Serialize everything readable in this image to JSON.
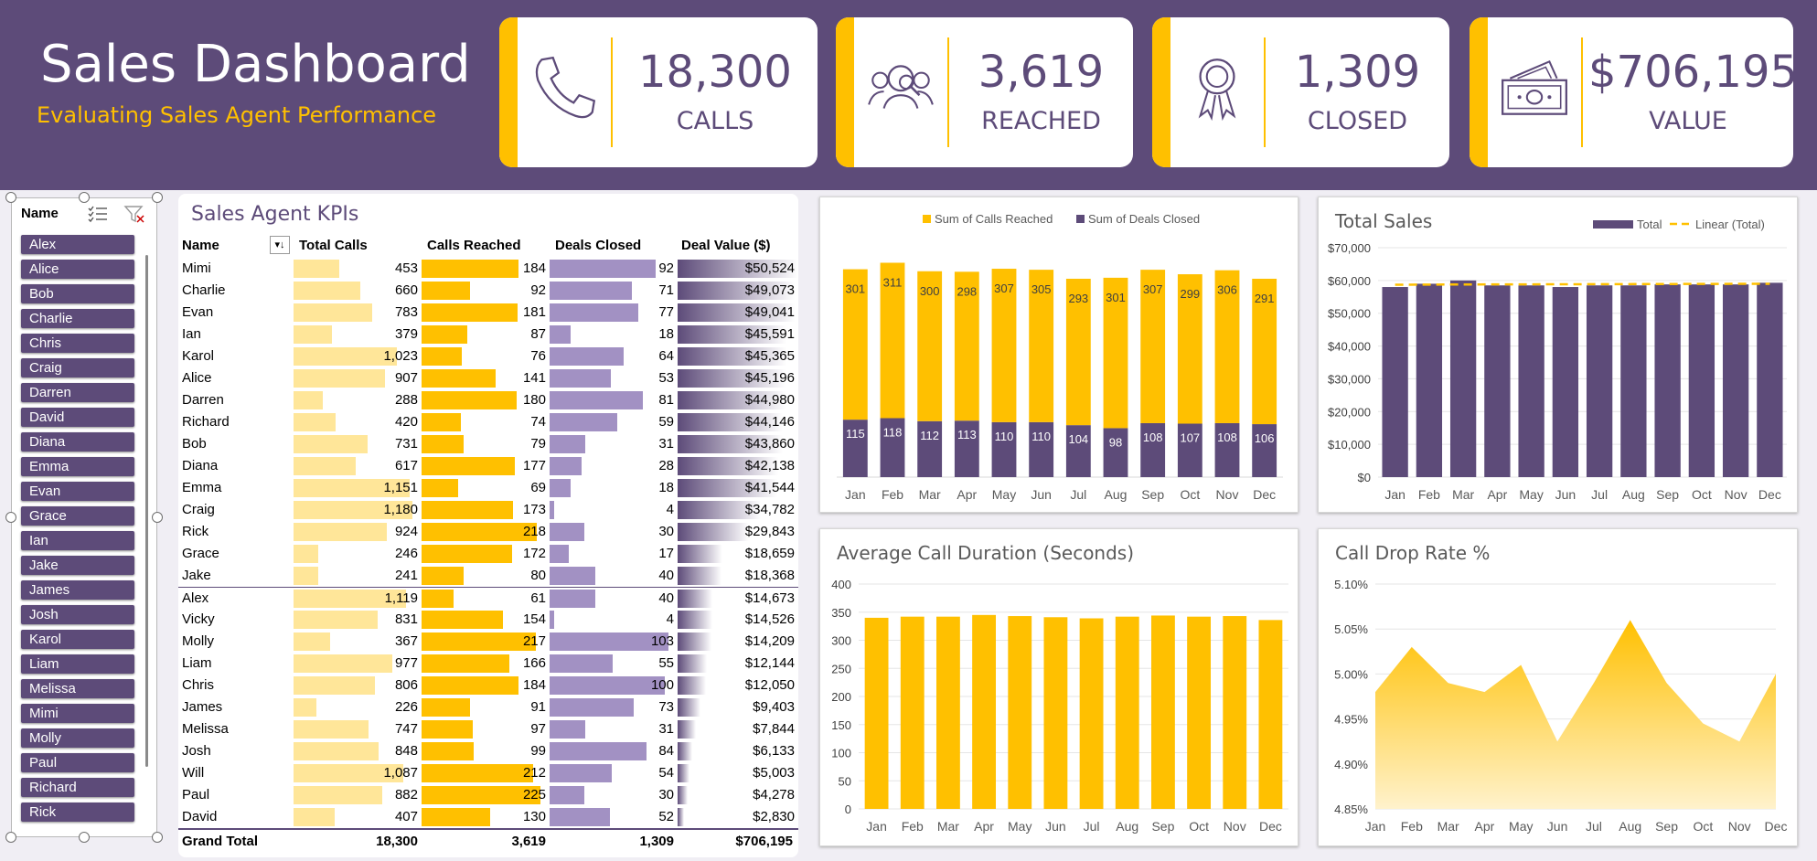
{
  "header": {
    "title": "Sales Dashboard",
    "subtitle": "Evaluating Sales Agent Performance"
  },
  "kpis": [
    {
      "value": "18,300",
      "label": "CALLS",
      "icon": "phone-icon"
    },
    {
      "value": "3,619",
      "label": "REACHED",
      "icon": "people-search-icon"
    },
    {
      "value": "1,309",
      "label": "CLOSED",
      "icon": "award-ribbon-icon"
    },
    {
      "value": "$706,195",
      "label": "VALUE",
      "icon": "money-icon"
    }
  ],
  "slicer": {
    "title": "Name",
    "items": [
      "Alex",
      "Alice",
      "Bob",
      "Charlie",
      "Chris",
      "Craig",
      "Darren",
      "David",
      "Diana",
      "Emma",
      "Evan",
      "Grace",
      "Ian",
      "Jake",
      "James",
      "Josh",
      "Karol",
      "Liam",
      "Melissa",
      "Mimi",
      "Molly",
      "Paul",
      "Richard",
      "Rick"
    ]
  },
  "agent_table": {
    "title": "Sales Agent KPIs",
    "columns": [
      "Name",
      "Total Calls",
      "Calls Reached",
      "Deals Closed",
      "Deal Value ($)"
    ],
    "max": {
      "calls": 1180,
      "reached": 225,
      "closed": 103,
      "value": 50524
    },
    "rows": [
      {
        "name": "Mimi",
        "calls": 453,
        "calls_t": "453",
        "reached": 184,
        "reached_t": "184",
        "closed": 92,
        "closed_t": "92",
        "value": 50524,
        "value_t": "$50,524"
      },
      {
        "name": "Charlie",
        "calls": 660,
        "calls_t": "660",
        "reached": 92,
        "reached_t": "92",
        "closed": 71,
        "closed_t": "71",
        "value": 49073,
        "value_t": "$49,073"
      },
      {
        "name": "Evan",
        "calls": 783,
        "calls_t": "783",
        "reached": 181,
        "reached_t": "181",
        "closed": 77,
        "closed_t": "77",
        "value": 49041,
        "value_t": "$49,041"
      },
      {
        "name": "Ian",
        "calls": 379,
        "calls_t": "379",
        "reached": 87,
        "reached_t": "87",
        "closed": 18,
        "closed_t": "18",
        "value": 45591,
        "value_t": "$45,591"
      },
      {
        "name": "Karol",
        "calls": 1023,
        "calls_t": "1,023",
        "reached": 76,
        "reached_t": "76",
        "closed": 64,
        "closed_t": "64",
        "value": 45365,
        "value_t": "$45,365"
      },
      {
        "name": "Alice",
        "calls": 907,
        "calls_t": "907",
        "reached": 141,
        "reached_t": "141",
        "closed": 53,
        "closed_t": "53",
        "value": 45196,
        "value_t": "$45,196"
      },
      {
        "name": "Darren",
        "calls": 288,
        "calls_t": "288",
        "reached": 180,
        "reached_t": "180",
        "closed": 81,
        "closed_t": "81",
        "value": 44980,
        "value_t": "$44,980"
      },
      {
        "name": "Richard",
        "calls": 420,
        "calls_t": "420",
        "reached": 74,
        "reached_t": "74",
        "closed": 59,
        "closed_t": "59",
        "value": 44146,
        "value_t": "$44,146"
      },
      {
        "name": "Bob",
        "calls": 731,
        "calls_t": "731",
        "reached": 79,
        "reached_t": "79",
        "closed": 31,
        "closed_t": "31",
        "value": 43860,
        "value_t": "$43,860"
      },
      {
        "name": "Diana",
        "calls": 617,
        "calls_t": "617",
        "reached": 177,
        "reached_t": "177",
        "closed": 28,
        "closed_t": "28",
        "value": 42138,
        "value_t": "$42,138"
      },
      {
        "name": "Emma",
        "calls": 1151,
        "calls_t": "1,151",
        "reached": 69,
        "reached_t": "69",
        "closed": 18,
        "closed_t": "18",
        "value": 41544,
        "value_t": "$41,544"
      },
      {
        "name": "Craig",
        "calls": 1180,
        "calls_t": "1,180",
        "reached": 173,
        "reached_t": "173",
        "closed": 4,
        "closed_t": "4",
        "value": 34782,
        "value_t": "$34,782"
      },
      {
        "name": "Rick",
        "calls": 924,
        "calls_t": "924",
        "reached": 218,
        "reached_t": "218",
        "closed": 30,
        "closed_t": "30",
        "value": 29843,
        "value_t": "$29,843"
      },
      {
        "name": "Grace",
        "calls": 246,
        "calls_t": "246",
        "reached": 172,
        "reached_t": "172",
        "closed": 17,
        "closed_t": "17",
        "value": 18659,
        "value_t": "$18,659"
      },
      {
        "name": "Jake",
        "calls": 241,
        "calls_t": "241",
        "reached": 80,
        "reached_t": "80",
        "closed": 40,
        "closed_t": "40",
        "value": 18368,
        "value_t": "$18,368"
      },
      {
        "name": "Alex",
        "calls": 1119,
        "calls_t": "1,119",
        "reached": 61,
        "reached_t": "61",
        "closed": 40,
        "closed_t": "40",
        "value": 14673,
        "value_t": "$14,673"
      },
      {
        "name": "Vicky",
        "calls": 831,
        "calls_t": "831",
        "reached": 154,
        "reached_t": "154",
        "closed": 4,
        "closed_t": "4",
        "value": 14526,
        "value_t": "$14,526"
      },
      {
        "name": "Molly",
        "calls": 367,
        "calls_t": "367",
        "reached": 217,
        "reached_t": "217",
        "closed": 103,
        "closed_t": "103",
        "value": 14209,
        "value_t": "$14,209"
      },
      {
        "name": "Liam",
        "calls": 977,
        "calls_t": "977",
        "reached": 166,
        "reached_t": "166",
        "closed": 55,
        "closed_t": "55",
        "value": 12144,
        "value_t": "$12,144"
      },
      {
        "name": "Chris",
        "calls": 806,
        "calls_t": "806",
        "reached": 184,
        "reached_t": "184",
        "closed": 100,
        "closed_t": "100",
        "value": 12050,
        "value_t": "$12,050"
      },
      {
        "name": "James",
        "calls": 226,
        "calls_t": "226",
        "reached": 91,
        "reached_t": "91",
        "closed": 73,
        "closed_t": "73",
        "value": 9403,
        "value_t": "$9,403"
      },
      {
        "name": "Melissa",
        "calls": 747,
        "calls_t": "747",
        "reached": 97,
        "reached_t": "97",
        "closed": 31,
        "closed_t": "31",
        "value": 7844,
        "value_t": "$7,844"
      },
      {
        "name": "Josh",
        "calls": 848,
        "calls_t": "848",
        "reached": 99,
        "reached_t": "99",
        "closed": 84,
        "closed_t": "84",
        "value": 6133,
        "value_t": "$6,133"
      },
      {
        "name": "Will",
        "calls": 1087,
        "calls_t": "1,087",
        "reached": 212,
        "reached_t": "212",
        "closed": 54,
        "closed_t": "54",
        "value": 5003,
        "value_t": "$5,003"
      },
      {
        "name": "Paul",
        "calls": 882,
        "calls_t": "882",
        "reached": 225,
        "reached_t": "225",
        "closed": 30,
        "closed_t": "30",
        "value": 4278,
        "value_t": "$4,278"
      },
      {
        "name": "David",
        "calls": 407,
        "calls_t": "407",
        "reached": 130,
        "reached_t": "130",
        "closed": 52,
        "closed_t": "52",
        "value": 2830,
        "value_t": "$2,830"
      }
    ],
    "grand_total": {
      "label": "Grand Total",
      "calls": "18,300",
      "reached": "3,619",
      "closed": "1,309",
      "value": "$706,195"
    }
  },
  "chart_data": [
    {
      "type": "bar",
      "stacked": true,
      "title": "",
      "categories": [
        "Jan",
        "Feb",
        "Mar",
        "Apr",
        "May",
        "Jun",
        "Jul",
        "Aug",
        "Sep",
        "Oct",
        "Nov",
        "Dec"
      ],
      "series": [
        {
          "name": "Sum of Calls Reached",
          "values": [
            301,
            311,
            300,
            298,
            307,
            305,
            293,
            301,
            307,
            299,
            306,
            291
          ],
          "color": "#ffc000"
        },
        {
          "name": "Sum of Deals Closed",
          "values": [
            115,
            118,
            112,
            113,
            110,
            110,
            104,
            98,
            108,
            107,
            108,
            106
          ],
          "color": "#5d4b79"
        }
      ],
      "legend": "top"
    },
    {
      "type": "bar",
      "title": "Total Sales",
      "categories": [
        "Jan",
        "Feb",
        "Mar",
        "Apr",
        "May",
        "Jun",
        "Jul",
        "Aug",
        "Sep",
        "Oct",
        "Nov",
        "Dec"
      ],
      "series": [
        {
          "name": "Total",
          "values": [
            58000,
            59000,
            60000,
            58500,
            58500,
            58000,
            58500,
            58500,
            58800,
            58800,
            58800,
            59300
          ],
          "color": "#5d4b79"
        },
        {
          "name": "Linear (Total)",
          "values": [
            58700,
            58750,
            58780,
            58800,
            58820,
            58850,
            58870,
            58900,
            58920,
            58950,
            58970,
            59000
          ],
          "color": "#ffc000"
        }
      ],
      "ylim": [
        0,
        70000
      ],
      "yticks": [
        "$0",
        "$10,000",
        "$20,000",
        "$30,000",
        "$40,000",
        "$50,000",
        "$60,000",
        "$70,000"
      ],
      "legend": "top-right"
    },
    {
      "type": "bar",
      "title": "Average Call Duration (Seconds)",
      "categories": [
        "Jan",
        "Feb",
        "Mar",
        "Apr",
        "May",
        "Jun",
        "Jul",
        "Aug",
        "Sep",
        "Oct",
        "Nov",
        "Dec"
      ],
      "values": [
        340,
        342,
        342,
        345,
        343,
        341,
        339,
        342,
        344,
        342,
        343,
        336
      ],
      "color": "#ffc000",
      "ylim": [
        0,
        400
      ],
      "yticks": [
        "0",
        "50",
        "100",
        "150",
        "200",
        "250",
        "300",
        "350",
        "400"
      ]
    },
    {
      "type": "area",
      "title": "Call Drop Rate %",
      "categories": [
        "Jan",
        "Feb",
        "Mar",
        "Apr",
        "May",
        "Jun",
        "Jul",
        "Aug",
        "Sep",
        "Oct",
        "Nov",
        "Dec"
      ],
      "values": [
        4.98,
        5.03,
        4.99,
        4.98,
        5.01,
        4.925,
        4.99,
        5.06,
        4.99,
        4.945,
        4.925,
        5.0
      ],
      "color": "#ffc000",
      "ylim": [
        4.85,
        5.1
      ],
      "yticks": [
        "4.85%",
        "4.90%",
        "4.95%",
        "5.00%",
        "5.05%",
        "5.10%"
      ]
    }
  ]
}
